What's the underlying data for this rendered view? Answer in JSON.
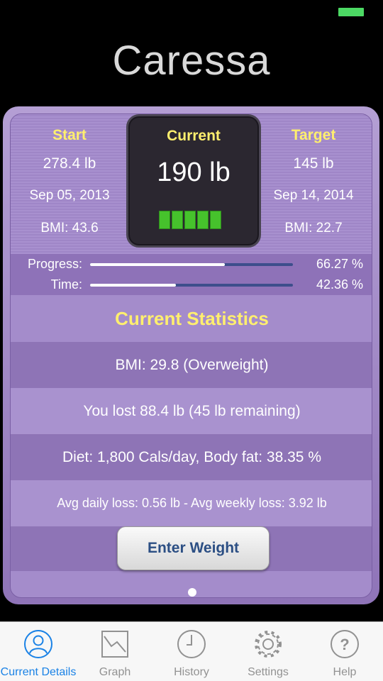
{
  "status": {
    "battery_color": "#4cd964"
  },
  "app": {
    "title": "Caressa"
  },
  "start": {
    "label": "Start",
    "weight": "278.4 lb",
    "date": "Sep 05, 2013",
    "bmi": "BMI: 43.6"
  },
  "current": {
    "label": "Current",
    "weight": "190 lb",
    "bars_filled": 5
  },
  "target": {
    "label": "Target",
    "weight": "145 lb",
    "date": "Sep 14, 2014",
    "bmi": "BMI: 22.7"
  },
  "progress": {
    "progress_label": "Progress:",
    "progress_pct": "66.27 %",
    "progress_value": 0.6627,
    "time_label": "Time:",
    "time_pct": "42.36 %",
    "time_value": 0.4236
  },
  "stats": {
    "title": "Current Statistics",
    "bmi": "BMI: 29.8 (Overweight)",
    "lost": "You lost 88.4 lb (45 lb remaining)",
    "diet": "Diet: 1,800 Cals/day, Body fat: 38.35 %",
    "avg": "Avg daily loss: 0.56 lb - Avg weekly loss: 3.92 lb"
  },
  "actions": {
    "enter_weight": "Enter Weight"
  },
  "tabs": [
    {
      "label": "Current Details",
      "icon": "person-icon",
      "active": true
    },
    {
      "label": "Graph",
      "icon": "graph-icon",
      "active": false
    },
    {
      "label": "History",
      "icon": "clock-icon",
      "active": false
    },
    {
      "label": "Settings",
      "icon": "gear-icon",
      "active": false
    },
    {
      "label": "Help",
      "icon": "help-icon",
      "active": false
    }
  ],
  "colors": {
    "accent_yellow": "#ffef6e",
    "tab_active": "#1a82e6",
    "panel_purple": "#a48ccb"
  }
}
